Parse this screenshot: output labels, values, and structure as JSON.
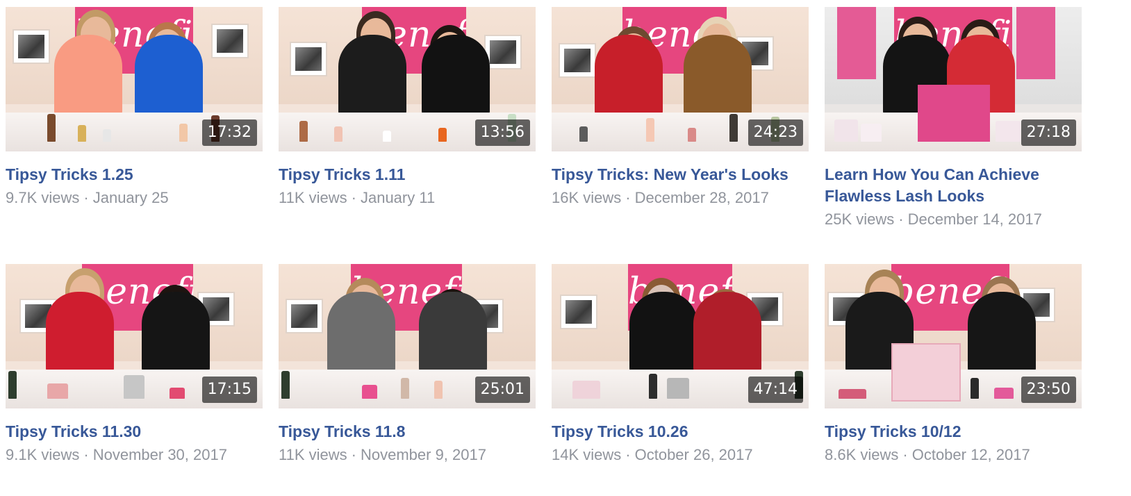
{
  "videos": [
    {
      "title": "Tipsy Tricks 1.25",
      "views": "9.7K views",
      "date": "January 25",
      "duration": "17:32",
      "sign_text": "benefit"
    },
    {
      "title": "Tipsy Tricks 1.11",
      "views": "11K views",
      "date": "January 11",
      "duration": "13:56",
      "sign_text": "benefit"
    },
    {
      "title": "Tipsy Tricks: New Year's Looks",
      "views": "16K views",
      "date": "December 28, 2017",
      "duration": "24:23",
      "sign_text": "benefit"
    },
    {
      "title": "Learn How You Can Achieve Flawless Lash Looks",
      "views": "25K views",
      "date": "December 14, 2017",
      "duration": "27:18",
      "sign_text": "benefit"
    },
    {
      "title": "Tipsy Tricks 11.30",
      "views": "9.1K views",
      "date": "November 30, 2017",
      "duration": "17:15",
      "sign_text": "benefit"
    },
    {
      "title": "Tipsy Tricks 11.8",
      "views": "11K views",
      "date": "November 9, 2017",
      "duration": "25:01",
      "sign_text": "benefit"
    },
    {
      "title": "Tipsy Tricks 10.26",
      "views": "14K views",
      "date": "October 26, 2017",
      "duration": "47:14",
      "sign_text": "benefit"
    },
    {
      "title": "Tipsy Tricks 10/12",
      "views": "8.6K views",
      "date": "October 12, 2017",
      "duration": "23:50",
      "sign_text": "benefit"
    }
  ],
  "meta_separator": "·",
  "colors": {
    "title_link": "#385898",
    "meta_text": "#90949c",
    "sign_pink": "#e6467f"
  }
}
